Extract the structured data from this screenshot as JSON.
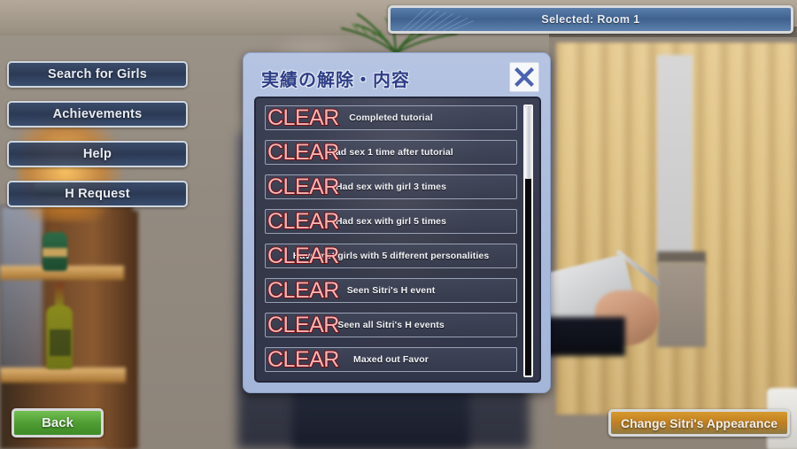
{
  "topbar": {
    "label": "Selected: Room 1"
  },
  "menu": {
    "items": [
      {
        "id": "search-for-girls",
        "label": "Search for Girls"
      },
      {
        "id": "achievements",
        "label": "Achievements"
      },
      {
        "id": "help",
        "label": "Help"
      },
      {
        "id": "h-request",
        "label": "H Request"
      }
    ]
  },
  "footer": {
    "back_label": "Back",
    "appearance_label": "Change Sitri's Appearance"
  },
  "dialog": {
    "title": "実績の解除・内容",
    "close_icon": "close-icon",
    "rows": [
      {
        "status": "CLEAR",
        "desc": "Completed tutorial"
      },
      {
        "status": "CLEAR",
        "desc": "Had sex 1 time after tutorial"
      },
      {
        "status": "CLEAR",
        "desc": "Had sex with girl 3 times"
      },
      {
        "status": "CLEAR",
        "desc": "Had sex with girl 5 times"
      },
      {
        "status": "CLEAR",
        "desc": "Have met girls with 5 different personalities"
      },
      {
        "status": "CLEAR",
        "desc": "Seen Sitri's H event"
      },
      {
        "status": "CLEAR",
        "desc": "Seen all Sitri's H events"
      },
      {
        "status": "CLEAR",
        "desc": "Maxed out Favor"
      }
    ],
    "scroll": {
      "thumb_percent": "27"
    }
  },
  "colors": {
    "dialog_bg": "#aabbdd",
    "list_bg": "#343848",
    "clear_red": "#f4b4b4",
    "clear_outline": "#6e0f14",
    "back_green": "#4e9c32",
    "appearance_orange": "#c07f1f",
    "topbar_blue": "#3f618d"
  }
}
